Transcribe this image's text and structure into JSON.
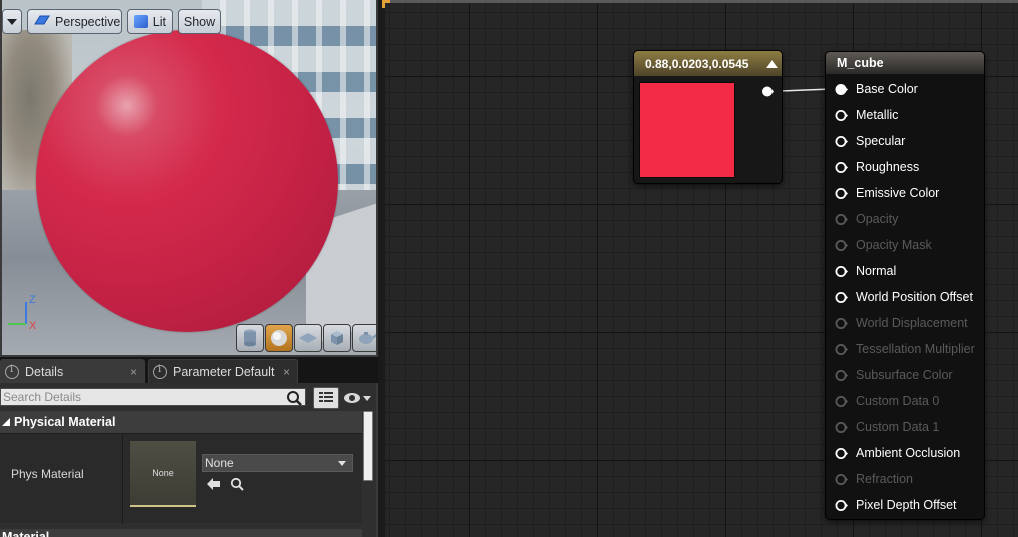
{
  "viewport": {
    "perspective_label": "Perspective",
    "lit_label": "Lit",
    "show_label": "Show",
    "axis_z": "Z",
    "axis_x": "X",
    "preview_shapes": [
      "cylinder-preview-icon",
      "sphere-preview-icon",
      "plane-preview-icon",
      "cube-preview-icon",
      "custom-mesh-preview-icon"
    ],
    "active_shape": "sphere-preview-icon"
  },
  "tabs": {
    "details_label": "Details",
    "parameter_defaults_label": "Parameter Defaults",
    "close_glyph": "×"
  },
  "details": {
    "search_placeholder": "Search Details",
    "physical_material_category": "Physical Material",
    "phys_material_label": "Phys Material",
    "phys_material_thumb_text": "None",
    "phys_material_value": "None",
    "material_category": "Material"
  },
  "graph": {
    "constant_node": {
      "title": "0.88,0.0203,0.0545",
      "color": "#F22A45"
    },
    "result_node": {
      "title": "M_cube",
      "pins": [
        {
          "label": "Base Color",
          "enabled": true,
          "connected": true
        },
        {
          "label": "Metallic",
          "enabled": true,
          "connected": false
        },
        {
          "label": "Specular",
          "enabled": true,
          "connected": false
        },
        {
          "label": "Roughness",
          "enabled": true,
          "connected": false
        },
        {
          "label": "Emissive Color",
          "enabled": true,
          "connected": false
        },
        {
          "label": "Opacity",
          "enabled": false,
          "connected": false
        },
        {
          "label": "Opacity Mask",
          "enabled": false,
          "connected": false
        },
        {
          "label": "Normal",
          "enabled": true,
          "connected": false
        },
        {
          "label": "World Position Offset",
          "enabled": true,
          "connected": false
        },
        {
          "label": "World Displacement",
          "enabled": false,
          "connected": false
        },
        {
          "label": "Tessellation Multiplier",
          "enabled": false,
          "connected": false
        },
        {
          "label": "Subsurface Color",
          "enabled": false,
          "connected": false
        },
        {
          "label": "Custom Data 0",
          "enabled": false,
          "connected": false
        },
        {
          "label": "Custom Data 1",
          "enabled": false,
          "connected": false
        },
        {
          "label": "Ambient Occlusion",
          "enabled": true,
          "connected": false
        },
        {
          "label": "Refraction",
          "enabled": false,
          "connected": false
        },
        {
          "label": "Pixel Depth Offset",
          "enabled": true,
          "connected": false
        }
      ]
    }
  },
  "colors": {
    "accent_orange": "#E3A13A",
    "sphere_red": "#C42245"
  }
}
